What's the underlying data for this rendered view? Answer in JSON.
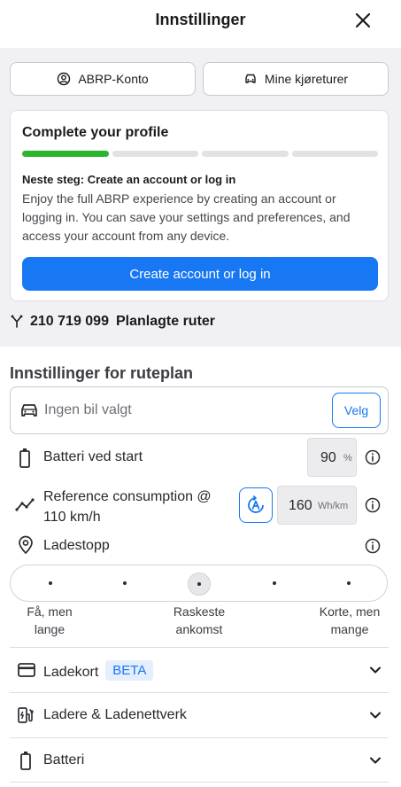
{
  "header": {
    "title": "Innstillinger"
  },
  "account": {
    "abrp_label": "ABRP-Konto",
    "trips_label": "Mine kjøreturer"
  },
  "profile_card": {
    "title": "Complete your profile",
    "progress_steps_done": 1,
    "progress_steps_total": 4,
    "next_step": "Neste steg: Create an account or log in",
    "body": "Enjoy the full ABRP experience by creating an account or logging in. You can save your settings and preferences, and access your account from any device.",
    "button": "Create account or log in"
  },
  "routes": {
    "count": "210 719 099",
    "label": "Planlagte ruter"
  },
  "route_settings": {
    "title": "Innstillinger for ruteplan",
    "car": {
      "placeholder": "Ingen bil valgt",
      "button": "Velg"
    },
    "battery": {
      "label": "Batteri ved start",
      "value": "90",
      "unit": "%"
    },
    "consumption": {
      "label_line1": "Reference consumption @",
      "label_line2": "110 km/h",
      "value": "160",
      "unit": "Wh/km"
    },
    "charge_stops": {
      "label": "Ladestopp",
      "selected_index": 2,
      "options": [
        {
          "line1": "Få, men",
          "line2": "lange"
        },
        {
          "line1": "Raskeste",
          "line2": "ankomst"
        },
        {
          "line1": "Korte, men",
          "line2": "mange"
        }
      ]
    }
  },
  "accordion": {
    "charge_cards": {
      "label": "Ladekort",
      "badge": "BETA"
    },
    "chargers": {
      "label": "Ladere & Ladenettverk"
    },
    "battery": {
      "label": "Batteri"
    }
  },
  "colors": {
    "accent": "#1878f3",
    "progress": "#2bb52f",
    "panel": "#f1f1f3"
  }
}
